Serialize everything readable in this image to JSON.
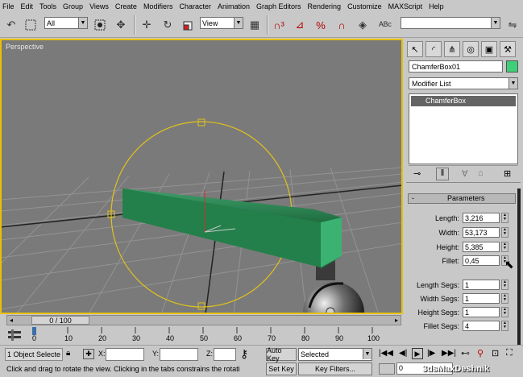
{
  "menu": [
    "File",
    "Edit",
    "Tools",
    "Group",
    "Views",
    "Create",
    "Modifiers",
    "Character",
    "Animation",
    "Graph Editors",
    "Rendering",
    "Customize",
    "MAXScript",
    "Help"
  ],
  "toolbar": {
    "selection_filter": "All",
    "reference_coord": "View"
  },
  "viewport": {
    "label": "Perspective"
  },
  "command_panel": {
    "object_name": "ChamferBox01",
    "object_color": "#3ecf78",
    "modifier_list": "Modifier List",
    "stack_item": "ChamferBox",
    "rollout_title": "Parameters",
    "rollout_toggle": "-",
    "params": [
      {
        "label": "Length:",
        "value": "3,216"
      },
      {
        "label": "Width:",
        "value": "53,173"
      },
      {
        "label": "Height:",
        "value": "5,385"
      },
      {
        "label": "Fillet:",
        "value": "0,45"
      },
      {
        "label": "Length Segs:",
        "value": "1"
      },
      {
        "label": "Width Segs:",
        "value": "1"
      },
      {
        "label": "Height Segs:",
        "value": "1"
      },
      {
        "label": "Fillet Segs:",
        "value": "4"
      }
    ]
  },
  "timeline": {
    "slider_text": "0 / 100",
    "ticks": [
      "0",
      "10",
      "20",
      "30",
      "40",
      "50",
      "60",
      "70",
      "80",
      "90",
      "100"
    ]
  },
  "status": {
    "selection": "1 Object Selecte",
    "x_label": "X:",
    "y_label": "Y:",
    "z_label": "Z:",
    "prompt": "Click and drag to rotate the view.  Clicking in the tabs constrains the rotati",
    "auto_key": "Auto Key",
    "set_key": "Set Key",
    "selected_dropdown": "Selected",
    "key_filters": "Key Filters...",
    "frame": "0",
    "watermark": "3dsMaxDeshnik"
  }
}
